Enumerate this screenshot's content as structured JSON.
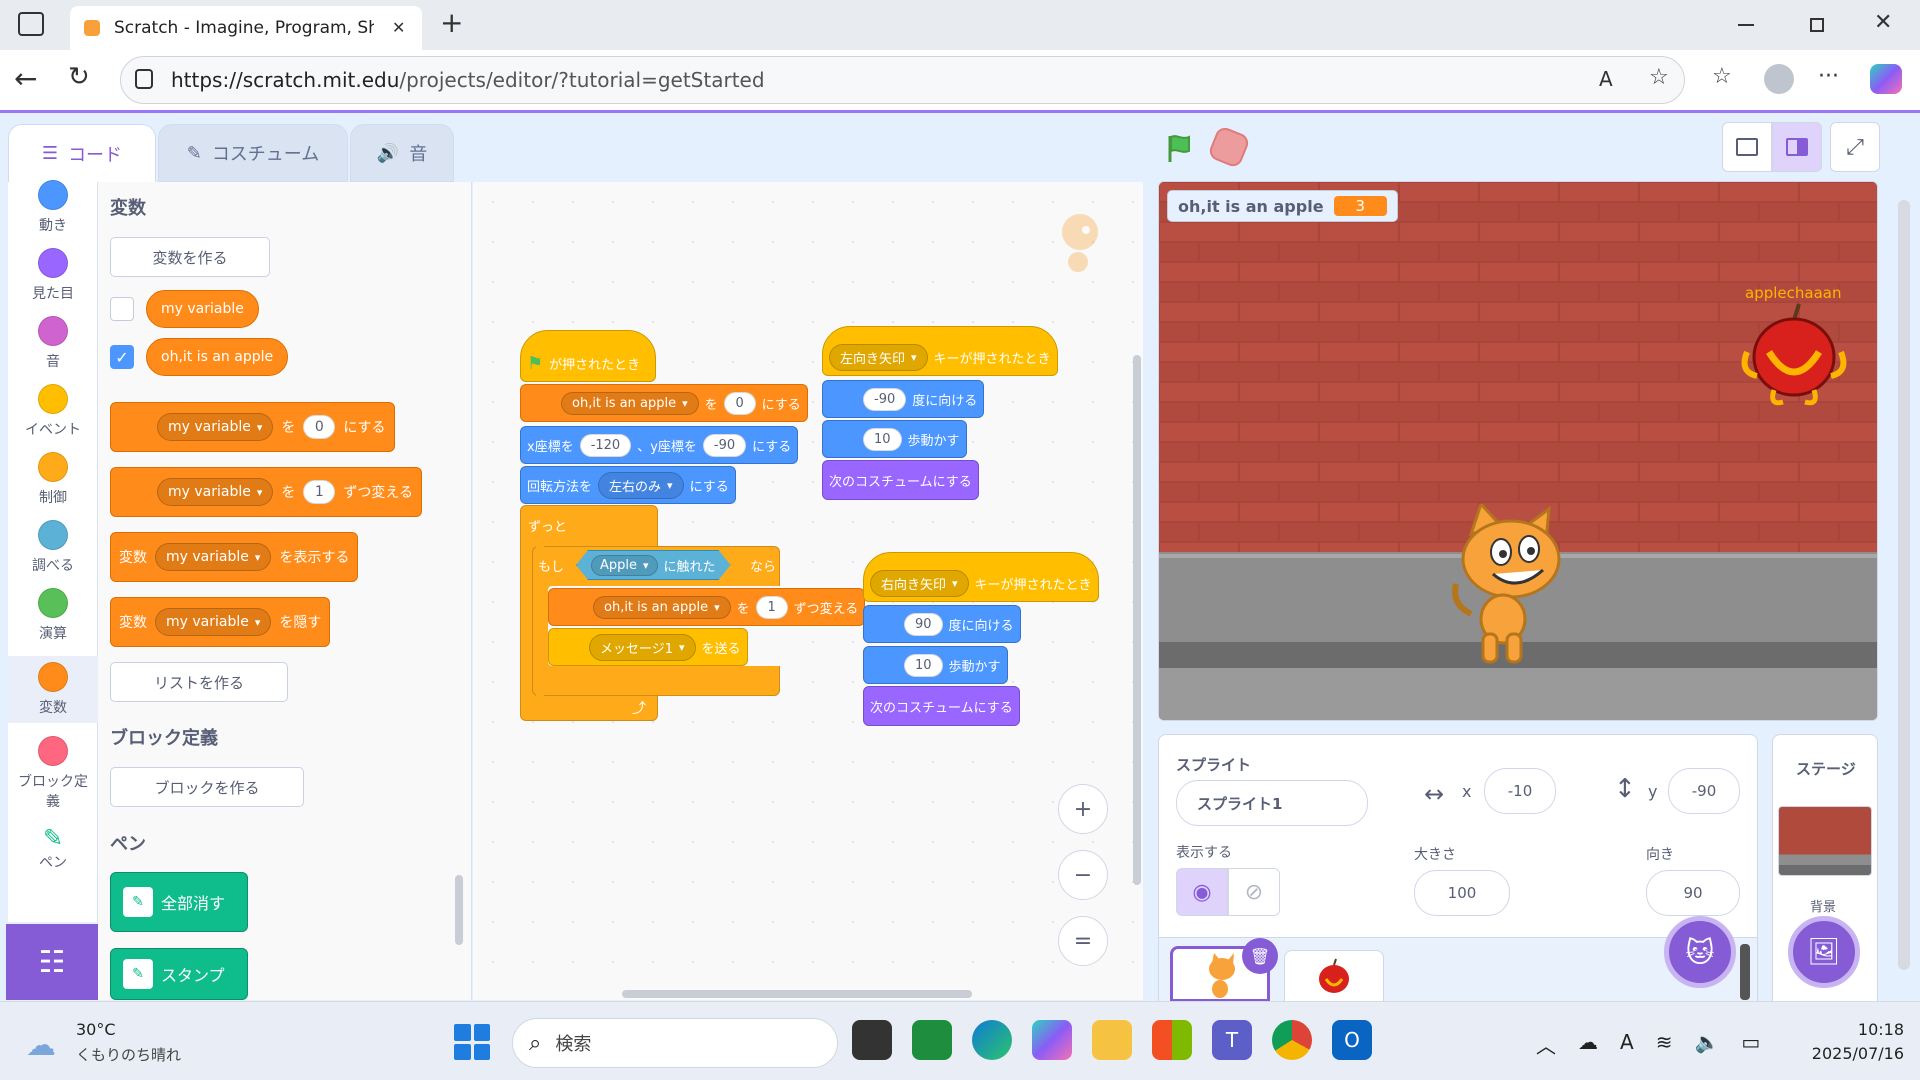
{
  "browser": {
    "tab_title": "Scratch - Imagine, Program, Share",
    "url_host": "https://scratch.mit.edu",
    "url_path": "/projects/editor/?tutorial=getStarted",
    "close_tab": "✕",
    "new_tab": "+"
  },
  "editor": {
    "tabs": [
      {
        "label": "コード"
      },
      {
        "label": "コスチューム"
      },
      {
        "label": "音"
      }
    ],
    "categories": [
      {
        "label": "動き",
        "color": "#4c97ff"
      },
      {
        "label": "見た目",
        "color": "#9966ff"
      },
      {
        "label": "音",
        "color": "#cf63cf"
      },
      {
        "label": "イベント",
        "color": "#ffbf00"
      },
      {
        "label": "制御",
        "color": "#ffab19"
      },
      {
        "label": "調べる",
        "color": "#5cb1d6"
      },
      {
        "label": "演算",
        "color": "#59c059"
      },
      {
        "label": "変数",
        "color": "#ff8c1a"
      },
      {
        "label": "ブロック定義",
        "color": "#ff6680"
      },
      {
        "label": "ペン",
        "color": "#0fbd8c"
      }
    ],
    "palette": {
      "variables_heading": "変数",
      "make_variable": "変数を作る",
      "var1": "my variable",
      "var2": "oh,it is an apple",
      "set_block": {
        "var": "my variable",
        "to": "を",
        "value": "0",
        "suffix": "にする"
      },
      "change_block": {
        "var": "my variable",
        "to": "を",
        "value": "1",
        "suffix": "ずつ変える"
      },
      "show_block": {
        "prefix": "変数",
        "var": "my variable",
        "suffix": "を表示する"
      },
      "hide_block": {
        "prefix": "変数",
        "var": "my variable",
        "suffix": "を隠す"
      },
      "make_list": "リストを作る",
      "myblocks_heading": "ブロック定義",
      "make_block": "ブロックを作る",
      "pen_heading": "ペン",
      "pen_clear": "全部消す",
      "pen_stamp": "スタンプ"
    },
    "scripts": {
      "s1": {
        "hat": "が押されたとき",
        "set_var": "oh,it is an apple",
        "set_to": "を",
        "set_val": "0",
        "set_suffix": "にする",
        "goto_x_label": "x座標を",
        "goto_x": "-120",
        "goto_y_label": "、y座標を",
        "goto_y": "-90",
        "goto_suffix": "にする",
        "rot_label": "回転方法を",
        "rot_val": "左右のみ",
        "rot_suffix": "にする",
        "forever": "ずっと",
        "if": "もし",
        "touch_obj": "Apple",
        "touch_suffix": "に触れた",
        "then": "なら",
        "chg_var": "oh,it is an apple",
        "chg_to": "を",
        "chg_val": "1",
        "chg_suffix": "ずつ変える",
        "msg": "メッセージ1",
        "msg_suffix": "を送る",
        "loop_arrow": "⤴"
      },
      "s2": {
        "key": "左向き矢印",
        "hat_suffix": "キーが押されたとき",
        "dir": "-90",
        "dir_suffix": "度に向ける",
        "steps": "10",
        "steps_suffix": "歩動かす",
        "next": "次のコスチュームにする"
      },
      "s3": {
        "key": "右向き矢印",
        "hat_suffix": "キーが押されたとき",
        "dir": "90",
        "dir_suffix": "度に向ける",
        "steps": "10",
        "steps_suffix": "歩動かす",
        "next": "次のコスチュームにする"
      }
    },
    "zoom": {
      "in": "+",
      "out": "−",
      "reset": "="
    }
  },
  "stage": {
    "monitor_label": "oh,it is an apple",
    "monitor_value": "3",
    "apple_label": "applechaaan"
  },
  "sprite_info": {
    "sprite_label": "スプライト",
    "sprite_name": "スプライト1",
    "x_label": "x",
    "x_value": "-10",
    "y_label": "y",
    "y_value": "-90",
    "show_label": "表示する",
    "size_label": "大きさ",
    "size_value": "100",
    "direction_label": "向き",
    "direction_value": "90"
  },
  "stage_panel": {
    "title": "ステージ",
    "backdrops_label": "背景"
  },
  "taskbar": {
    "weather_temp": "30°C",
    "weather_desc": "くもりのち晴れ",
    "search_placeholder": "検索",
    "time": "10:18",
    "date": "2025/07/16"
  },
  "colors": {
    "scratch_purple": "#855cd6",
    "variables_orange": "#ff8c1a",
    "events_yellow": "#ffbf00",
    "motion_blue": "#4c97ff",
    "looks_purple": "#9966ff"
  }
}
